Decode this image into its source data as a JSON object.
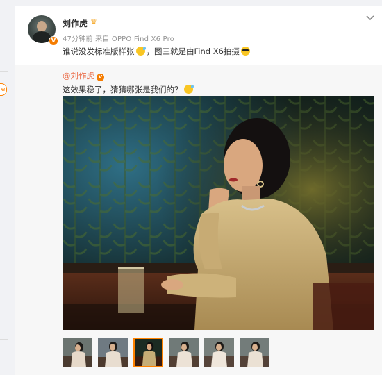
{
  "post": {
    "author": "刘作虎",
    "avatar_badge": "V",
    "meta": "47分钟前 来自 OPPO Find X6 Pro",
    "text_before": "谁说没发标准版样张",
    "text_after": "，图三就是由Find X6拍摄",
    "emoji_1": "sweat-smile-emoji",
    "emoji_2": "sunglasses-emoji"
  },
  "repost": {
    "author": "@刘作虎",
    "author_badge": "V",
    "text": "这效果稳了，猜猜哪张是我们的？"
  },
  "gallery": {
    "active_index": 2,
    "thumb_count": 6
  },
  "colors": {
    "accent": "#ff8200",
    "verified": "#f57c00",
    "link": "#eb7350"
  }
}
